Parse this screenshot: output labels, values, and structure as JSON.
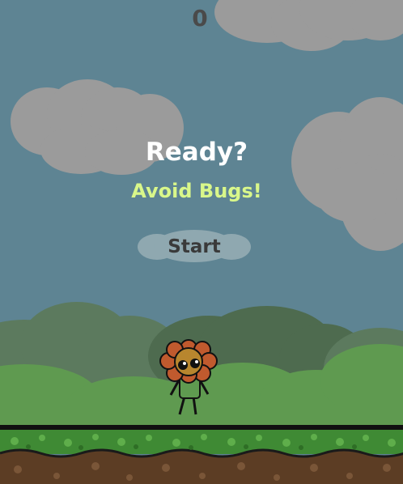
{
  "game": {
    "score": "0",
    "title": "Ready?",
    "subtitle": "Avoid Bugs!",
    "start_label": "Start"
  },
  "colors": {
    "sky": "#5e8493",
    "cloud": "#9b9b9b",
    "title": "#ffffff",
    "subtitle": "#d9f78a",
    "score": "#4a4a4a",
    "hills_back": "#5c7a5e",
    "hills_mid": "#4e6b4f",
    "hills_front": "#5f9a50",
    "grass": "#3f8a34",
    "dirt": "#5c3d24"
  },
  "player": {
    "icon": "flower-character-icon"
  }
}
